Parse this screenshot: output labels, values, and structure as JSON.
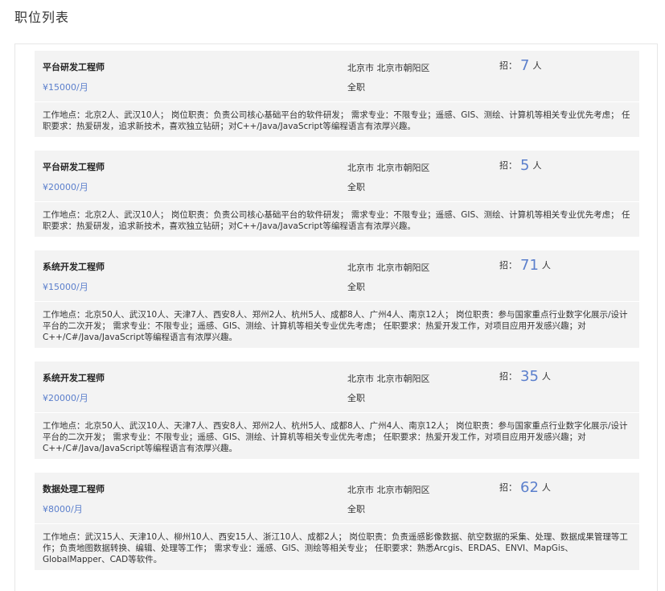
{
  "page_title": "职位列表",
  "jobs": [
    {
      "title": "平台研发工程师",
      "salary": "¥15000/月",
      "location": "北京市 北京市朝阳区",
      "type": "全职",
      "recruit_prefix": "招：",
      "recruit_count": "7",
      "recruit_suffix": "人",
      "description": "工作地点：北京2人、武汉10人； 岗位职责：负责公司核心基础平台的软件研发； 需求专业：不限专业；遥感、GIS、测绘、计算机等相关专业优先考虑； 任职要求：热爱研发，追求新技术，喜欢独立钻研；对C++/Java/JavaScript等编程语言有浓厚兴趣。"
    },
    {
      "title": "平台研发工程师",
      "salary": "¥20000/月",
      "location": "北京市 北京市朝阳区",
      "type": "全职",
      "recruit_prefix": "招：",
      "recruit_count": "5",
      "recruit_suffix": "人",
      "description": "工作地点：北京2人、武汉10人； 岗位职责：负责公司核心基础平台的软件研发； 需求专业：不限专业；遥感、GIS、测绘、计算机等相关专业优先考虑； 任职要求：热爱研发，追求新技术，喜欢独立钻研；对C++/Java/JavaScript等编程语言有浓厚兴趣。"
    },
    {
      "title": "系统开发工程师",
      "salary": "¥15000/月",
      "location": "北京市 北京市朝阳区",
      "type": "全职",
      "recruit_prefix": "招：",
      "recruit_count": "71",
      "recruit_suffix": "人",
      "description": "工作地点：北京50人、武汉10人、天津7人、西安8人、郑州2人、杭州5人、成都8人、广州4人、南京12人； 岗位职责：参与国家重点行业数字化展示/设计平台的二次开发； 需求专业：不限专业；遥感、GIS、测绘、计算机等相关专业优先考虑； 任职要求：热爱开发工作，对项目应用开发感兴趣；对C++/C#/Java/JavaScript等编程语言有浓厚兴趣。"
    },
    {
      "title": "系统开发工程师",
      "salary": "¥20000/月",
      "location": "北京市 北京市朝阳区",
      "type": "全职",
      "recruit_prefix": "招：",
      "recruit_count": "35",
      "recruit_suffix": "人",
      "description": "工作地点：北京50人、武汉10人、天津7人、西安8人、郑州2人、杭州5人、成都8人、广州4人、南京12人； 岗位职责：参与国家重点行业数字化展示/设计平台的二次开发； 需求专业：不限专业；遥感、GIS、测绘、计算机等相关专业优先考虑； 任职要求：热爱开发工作，对项目应用开发感兴趣；对C++/C#/Java/JavaScript等编程语言有浓厚兴趣。"
    },
    {
      "title": "数据处理工程师",
      "salary": "¥8000/月",
      "location": "北京市 北京市朝阳区",
      "type": "全职",
      "recruit_prefix": "招：",
      "recruit_count": "62",
      "recruit_suffix": "人",
      "description": "工作地点：武汉15人、天津10人、柳州10人、西安15人、浙江10人、成都2人； 岗位职责：负责遥感影像数据、航空数据的采集、处理、数据成果管理等工作；负责地图数据转换、编辑、处理等工作； 需求专业：遥感、GIS、测绘等相关专业； 任职要求：熟悉Arcgis、ERDAS、ENVI、MapGis、GlobalMapper、CAD等软件。"
    }
  ]
}
